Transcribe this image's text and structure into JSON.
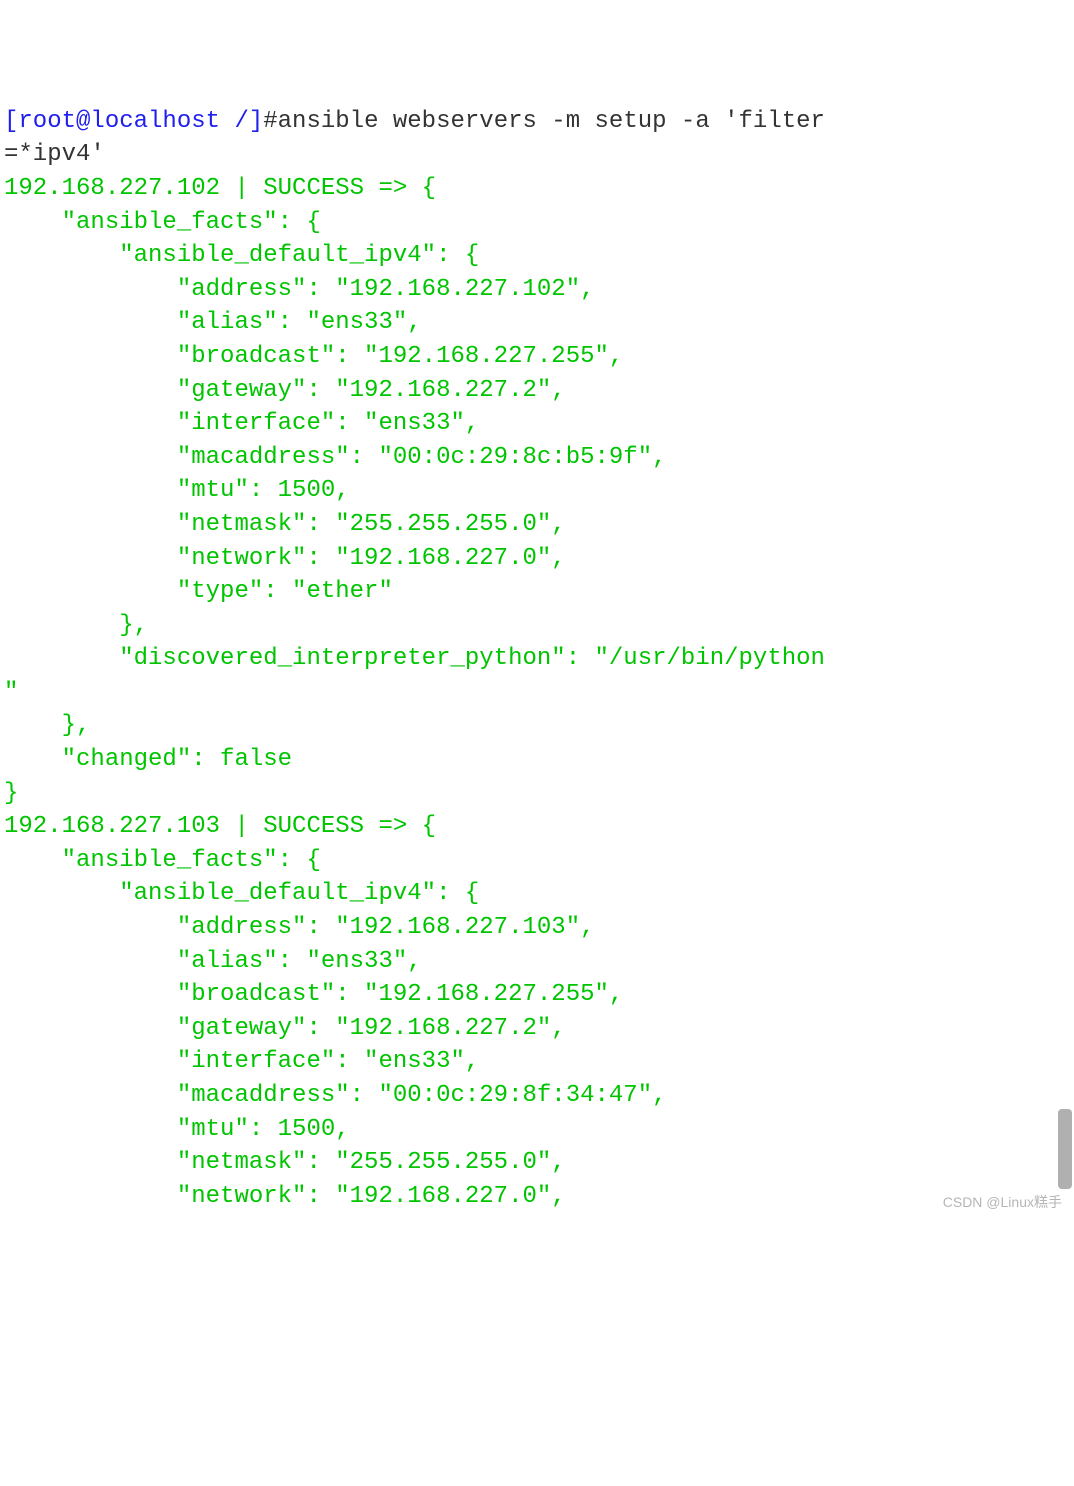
{
  "prompt": {
    "user_host": "[root@localhost /]",
    "hash": "#",
    "command": "ansible webservers -m setup -a 'filter=*ipv4'"
  },
  "hosts": [
    {
      "ip": "192.168.227.102",
      "status": "SUCCESS",
      "ansible_facts": {
        "ansible_default_ipv4": {
          "address": "192.168.227.102",
          "alias": "ens33",
          "broadcast": "192.168.227.255",
          "gateway": "192.168.227.2",
          "interface": "ens33",
          "macaddress": "00:0c:29:8c:b5:9f",
          "mtu": 1500,
          "netmask": "255.255.255.0",
          "network": "192.168.227.0",
          "type": "ether"
        },
        "discovered_interpreter_python": "/usr/bin/python"
      },
      "changed": false,
      "complete": true
    },
    {
      "ip": "192.168.227.103",
      "status": "SUCCESS",
      "ansible_facts": {
        "ansible_default_ipv4": {
          "address": "192.168.227.103",
          "alias": "ens33",
          "broadcast": "192.168.227.255",
          "gateway": "192.168.227.2",
          "interface": "ens33",
          "macaddress": "00:0c:29:8f:34:47",
          "mtu": 1500,
          "netmask": "255.255.255.0",
          "network": "192.168.227.0"
        }
      },
      "complete": false
    }
  ],
  "watermark": "CSDN @Linux糕手"
}
